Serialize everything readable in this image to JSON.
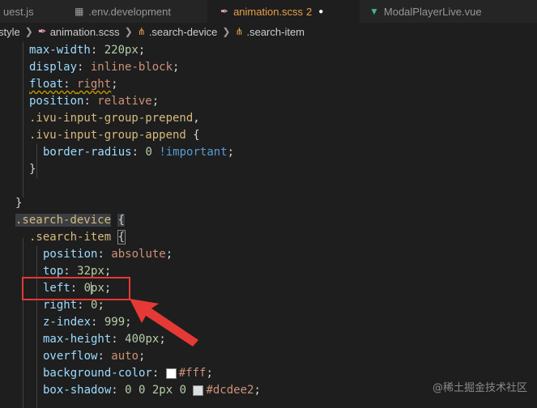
{
  "tabs": [
    {
      "label": "uest.js",
      "icon": "js-file-icon",
      "color": "#cbcb41",
      "active": false
    },
    {
      "label": ".env.development",
      "icon": "env-file-icon",
      "color": "#a0a0a0",
      "active": false
    },
    {
      "label": "animation.scss",
      "badge": "2",
      "icon": "scss-file-icon",
      "color": "#e5a3c0",
      "active": true,
      "modified": true
    },
    {
      "label": "ModalPlayerLive.vue",
      "icon": "vue-file-icon",
      "color": "#41b883",
      "active": false
    }
  ],
  "breadcrumb": {
    "items": [
      "style",
      "animation.scss",
      ".search-device",
      ".search-item"
    ]
  },
  "code": {
    "lines": [
      "max-width: 220px;",
      "display: inline-block;",
      "float: right;",
      "position: relative;",
      ".ivu-input-group-prepend,",
      ".ivu-input-group-append {",
      "border-radius: 0 !important;",
      "}",
      "",
      "}",
      ".search-device {",
      ".search-item {",
      "position: absolute;",
      "top: 32px;",
      "left: 0px;",
      "right: 0;",
      "z-index: 999;",
      "max-height: 400px;",
      "overflow: auto;",
      "background-color: #fff;",
      "box-shadow: 0 0 2px 0 #dcdee2;"
    ]
  },
  "colors": {
    "swatch_white": "#ffffff",
    "swatch_gray": "#dcdee2",
    "highlight_box": "#e53935"
  },
  "watermark": {
    "text": "@稀土掘金技术社区"
  }
}
